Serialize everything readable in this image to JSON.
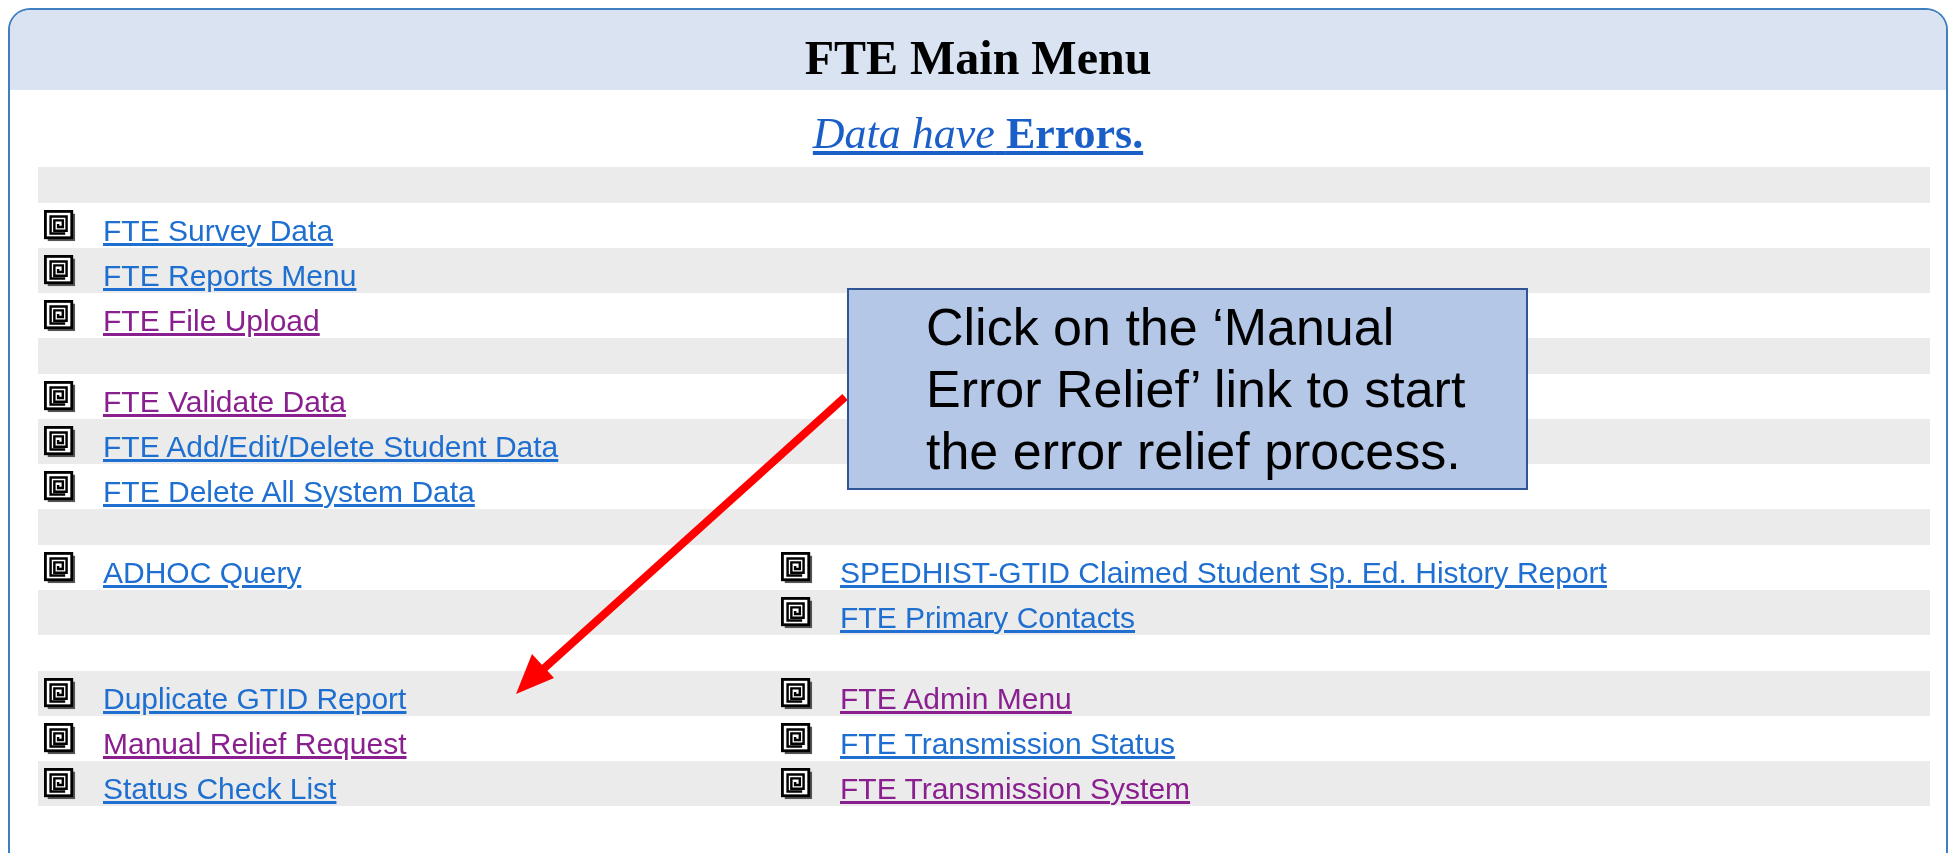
{
  "title": "FTE Main Menu",
  "status_link": "*Data have* **Errors.**",
  "rows": [
    {
      "kind": "spacer"
    },
    {
      "kind": "links",
      "left": {
        "label": "FTE Survey Data",
        "visited": false
      }
    },
    {
      "kind": "links",
      "left": {
        "label": "FTE Reports Menu",
        "visited": false
      }
    },
    {
      "kind": "links",
      "left": {
        "label": "FTE File Upload",
        "visited": true
      }
    },
    {
      "kind": "spacer"
    },
    {
      "kind": "links",
      "left": {
        "label": "FTE Validate Data",
        "visited": true
      }
    },
    {
      "kind": "links",
      "left": {
        "label": "FTE Add/Edit/Delete Student Data",
        "visited": false
      }
    },
    {
      "kind": "links",
      "left": {
        "label": "FTE Delete All System Data",
        "visited": false
      }
    },
    {
      "kind": "spacer"
    },
    {
      "kind": "links",
      "left": {
        "label": "ADHOC Query",
        "visited": false
      },
      "right": {
        "label": "SPEDHIST-GTID Claimed Student Sp. Ed. History Report",
        "visited": false
      }
    },
    {
      "kind": "links",
      "right": {
        "label": "FTE Primary Contacts",
        "visited": false
      }
    },
    {
      "kind": "spacer"
    },
    {
      "kind": "links",
      "left": {
        "label": "Duplicate GTID Report",
        "visited": false
      },
      "right": {
        "label": "FTE Admin Menu",
        "visited": true
      }
    },
    {
      "kind": "links",
      "left": {
        "label": "Manual Relief Request",
        "visited": true
      },
      "right": {
        "label": "FTE Transmission Status",
        "visited": false
      }
    },
    {
      "kind": "links",
      "left": {
        "label": "Status Check List",
        "visited": false
      },
      "right": {
        "label": "FTE Transmission System",
        "visited": true
      }
    }
  ],
  "callout": {
    "text": "Click on the ‘Manual Error Relief’ link to start the error relief process."
  }
}
